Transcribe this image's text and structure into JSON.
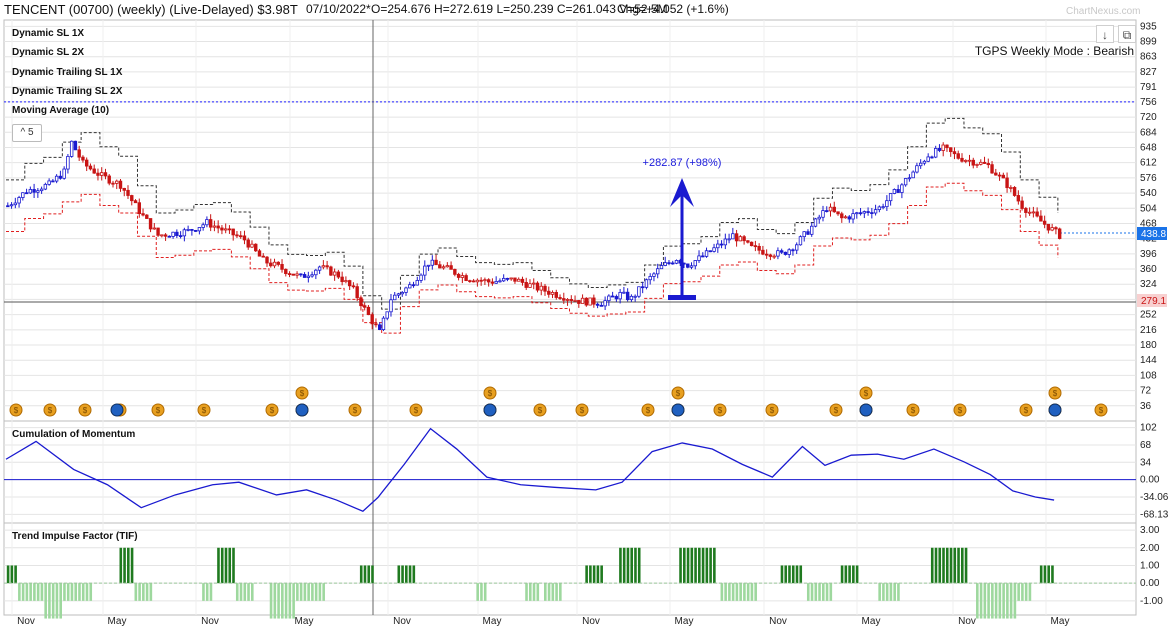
{
  "header": {
    "title": "TENCENT (00700)  (weekly) (Live-Delayed) $3.98T",
    "date": "07/10/2022*",
    "ohlc": "O=254.676 H=272.619 L=250.239 C=261.043 V=52.5M",
    "chg": "Chg=+4.052 (+1.6%)",
    "watermark": "ChartNexus.com"
  },
  "toolbar": {
    "download_icon": "download-arrow-icon",
    "popout_icon": "external-link-icon"
  },
  "legend": {
    "items": [
      "Dynamic SL 1X",
      "Dynamic SL 2X",
      "Dynamic Trailing SL 1X",
      "Dynamic Trailing SL 2X",
      "Moving Average (10)"
    ],
    "period_badge": "5",
    "mode": "TGPS Weekly Mode : Bearish"
  },
  "annotation": {
    "text": "+282.87 (+98%)",
    "color": "#1a1adc"
  },
  "colors": {
    "up": "#1a1ad0",
    "down": "#c81414",
    "upper_sl": "#333333",
    "lower_sl": "#e02020",
    "ref": "#2020ff",
    "tif_up": "#1f7a1f",
    "tif_down": "#9ed89e",
    "coin": "#e8a020"
  },
  "chart_data": [
    {
      "type": "candlestick",
      "title": "TENCENT (00700)",
      "y_ticks": [
        935,
        899,
        863,
        827,
        791,
        756,
        720,
        684,
        648,
        612,
        576,
        540,
        504,
        468,
        432,
        396,
        360,
        324,
        288,
        252,
        216,
        180,
        144,
        108,
        72,
        36
      ],
      "ylim": [
        0,
        950
      ],
      "last_price": "438.8",
      "ref_price": "279.1",
      "ref_level": 756,
      "x_ticks": [
        "Nov",
        "May",
        "Nov",
        "May",
        "Nov",
        "May",
        "Nov",
        "May",
        "Nov",
        "May",
        "Nov",
        "May"
      ],
      "close_trend": [
        [
          0,
          510
        ],
        [
          5,
          545
        ],
        [
          11,
          560
        ],
        [
          15,
          590
        ],
        [
          17,
          660
        ],
        [
          20,
          610
        ],
        [
          25,
          580
        ],
        [
          30,
          560
        ],
        [
          36,
          485
        ],
        [
          40,
          440
        ],
        [
          48,
          450
        ],
        [
          53,
          470
        ],
        [
          58,
          450
        ],
        [
          63,
          430
        ],
        [
          68,
          380
        ],
        [
          72,
          365
        ],
        [
          78,
          340
        ],
        [
          83,
          365
        ],
        [
          88,
          345
        ],
        [
          92,
          310
        ],
        [
          96,
          250
        ],
        [
          99,
          210
        ],
        [
          102,
          290
        ],
        [
          107,
          320
        ],
        [
          112,
          375
        ],
        [
          117,
          360
        ],
        [
          122,
          340
        ],
        [
          128,
          330
        ],
        [
          135,
          335
        ],
        [
          141,
          315
        ],
        [
          146,
          300
        ],
        [
          152,
          285
        ],
        [
          158,
          280
        ],
        [
          163,
          300
        ],
        [
          166,
          290
        ],
        [
          170,
          330
        ],
        [
          174,
          365
        ],
        [
          178,
          385
        ],
        [
          181,
          370
        ],
        [
          185,
          390
        ],
        [
          190,
          420
        ],
        [
          193,
          440
        ],
        [
          198,
          410
        ],
        [
          202,
          400
        ],
        [
          206,
          395
        ],
        [
          210,
          420
        ],
        [
          214,
          460
        ],
        [
          218,
          505
        ],
        [
          222,
          480
        ],
        [
          228,
          495
        ],
        [
          232,
          505
        ],
        [
          236,
          540
        ],
        [
          241,
          590
        ],
        [
          245,
          630
        ],
        [
          249,
          645
        ],
        [
          253,
          625
        ],
        [
          257,
          615
        ],
        [
          261,
          605
        ],
        [
          266,
          560
        ],
        [
          270,
          510
        ],
        [
          274,
          480
        ],
        [
          277,
          460
        ],
        [
          280,
          440
        ]
      ]
    },
    {
      "type": "line",
      "title": "Cumulation of Momentum",
      "y_ticks": [
        102,
        68,
        34,
        0.0,
        -34.06,
        -68.13
      ],
      "ylim": [
        -85,
        115
      ],
      "series": [
        [
          0,
          40
        ],
        [
          8,
          75
        ],
        [
          18,
          20
        ],
        [
          27,
          -10
        ],
        [
          36,
          -55
        ],
        [
          45,
          -30
        ],
        [
          55,
          -10
        ],
        [
          62,
          -5
        ],
        [
          72,
          -30
        ],
        [
          80,
          -20
        ],
        [
          88,
          -40
        ],
        [
          95,
          -62
        ],
        [
          99,
          -35
        ],
        [
          106,
          30
        ],
        [
          113,
          100
        ],
        [
          120,
          60
        ],
        [
          128,
          5
        ],
        [
          137,
          -10
        ],
        [
          146,
          -15
        ],
        [
          157,
          -20
        ],
        [
          164,
          -5
        ],
        [
          172,
          55
        ],
        [
          180,
          72
        ],
        [
          188,
          60
        ],
        [
          196,
          30
        ],
        [
          204,
          5
        ],
        [
          212,
          65
        ],
        [
          218,
          28
        ],
        [
          225,
          48
        ],
        [
          232,
          50
        ],
        [
          239,
          40
        ],
        [
          247,
          60
        ],
        [
          255,
          35
        ],
        [
          262,
          10
        ],
        [
          268,
          -22
        ],
        [
          274,
          -34
        ],
        [
          279,
          -40
        ]
      ]
    },
    {
      "type": "bar",
      "title": "Trend Impulse Factor (TIF)",
      "y_ticks": [
        3.0,
        2.0,
        1.0,
        0.0,
        -1.0
      ],
      "ylim": [
        -1.8,
        3.4
      ],
      "segments": [
        [
          0,
          2,
          1
        ],
        [
          3,
          9,
          -1
        ],
        [
          10,
          14,
          -2
        ],
        [
          15,
          22,
          -1
        ],
        [
          30,
          33,
          2
        ],
        [
          34,
          38,
          -1
        ],
        [
          52,
          54,
          -1
        ],
        [
          56,
          60,
          2
        ],
        [
          61,
          65,
          -1
        ],
        [
          70,
          76,
          -2
        ],
        [
          77,
          84,
          -1
        ],
        [
          94,
          97,
          1
        ],
        [
          104,
          108,
          1
        ],
        [
          125,
          127,
          -1
        ],
        [
          138,
          141,
          -1
        ],
        [
          143,
          147,
          -1
        ],
        [
          154,
          158,
          1
        ],
        [
          163,
          168,
          2
        ],
        [
          179,
          188,
          2
        ],
        [
          190,
          199,
          -1
        ],
        [
          206,
          211,
          1
        ],
        [
          213,
          219,
          -1
        ],
        [
          222,
          226,
          1
        ],
        [
          232,
          237,
          -1
        ],
        [
          246,
          255,
          2
        ],
        [
          258,
          268,
          -2
        ],
        [
          269,
          272,
          -1
        ],
        [
          275,
          278,
          1
        ]
      ]
    }
  ]
}
